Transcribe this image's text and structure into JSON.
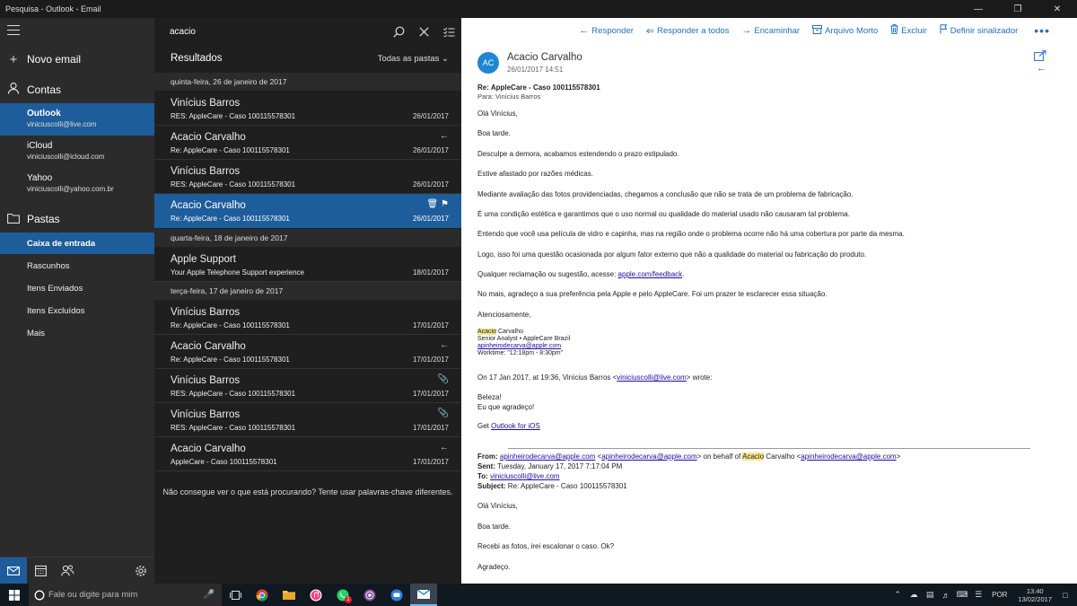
{
  "window": {
    "title": "Pesquisa - Outlook - Email"
  },
  "nav": {
    "new_mail": "Novo email",
    "accounts_label": "Contas",
    "accounts": [
      {
        "name": "Outlook",
        "email": "viniciuscolli@live.com"
      },
      {
        "name": "iCloud",
        "email": "viniciuscolli@icloud.com"
      },
      {
        "name": "Yahoo",
        "email": "viniciuscolli@yahoo.com.br"
      }
    ],
    "folders_label": "Pastas",
    "folders": [
      "Caixa de entrada",
      "Rascunhos",
      "Itens Enviados",
      "Itens Excluídos",
      "Mais"
    ]
  },
  "list": {
    "search_query": "acacio",
    "results_label": "Resultados",
    "filter_label": "Todas as pastas",
    "date_groups": [
      "quinta-feira, 26 de janeiro de 2017",
      "quarta-feira, 18 de janeiro de 2017",
      "terça-feira, 17 de janeiro de 2017"
    ],
    "messages": [
      {
        "sender": "Vinícius Barros",
        "subject": "RES: AppleCare - Caso 100115578301",
        "date": "26/01/2017",
        "flags": ""
      },
      {
        "sender": "Acacio Carvalho",
        "subject": "Re: AppleCare - Caso 100115578301",
        "date": "26/01/2017",
        "flags": "←"
      },
      {
        "sender": "Vinícius Barros",
        "subject": "RES: AppleCare - Caso 100115578301",
        "date": "26/01/2017",
        "flags": ""
      },
      {
        "sender": "Acacio Carvalho",
        "subject": "Re: AppleCare - Caso 100115578301",
        "date": "26/01/2017",
        "flags": "🗑 ⚑"
      },
      {
        "sender": "Apple Support",
        "subject": "Your Apple Telephone Support experience",
        "date": "18/01/2017",
        "flags": ""
      },
      {
        "sender": "Vinícius Barros",
        "subject": "Re: AppleCare - Caso 100115578301",
        "date": "17/01/2017",
        "flags": ""
      },
      {
        "sender": "Acacio Carvalho",
        "subject": "Re: AppleCare - Caso 100115578301",
        "date": "17/01/2017",
        "flags": "←"
      },
      {
        "sender": "Vinícius Barros",
        "subject": "RES: AppleCare - Caso 100115578301",
        "date": "17/01/2017",
        "flags": "📎"
      },
      {
        "sender": "Vinícius Barros",
        "subject": "RES: AppleCare - Caso 100115578301",
        "date": "17/01/2017",
        "flags": "📎"
      },
      {
        "sender": "Acacio Carvalho",
        "subject": "AppleCare - Caso 100115578301",
        "date": "17/01/2017",
        "flags": "←"
      }
    ],
    "empty_hint": "Não consegue ver o que está procurando? Tente usar palavras-chave diferentes."
  },
  "reader": {
    "toolbar": {
      "reply": "Responder",
      "reply_all": "Responder a todos",
      "forward": "Encaminhar",
      "archive": "Arquivo Morto",
      "delete": "Excluir",
      "flag": "Definir sinalizador"
    },
    "avatar_initials": "AC",
    "from_name": "Acacio Carvalho",
    "from_date": "26/01/2017 14:51",
    "subject": "Re: AppleCare - Caso 100115578301",
    "to": "Para: Vinícius Barros",
    "body": {
      "p1": "Olá Vinícius,",
      "p2": "Boa tarde.",
      "p3": "Desculpe a demora, acabamos estendendo o prazo estipulado.",
      "p4": "Estive afastado por razões médicas.",
      "p5": "Mediante avaliação das fotos providenciadas, chegamos a conclusão que não se trata de um problema de fabricação.",
      "p6": "É uma condição estética e garantimos que o uso normal ou qualidade do material usado não causaram tal problema.",
      "p7": "Entendo que você usa película de vidro e capinha, mas na região onde o problema ocorre não há uma cobertura por parte da mesma.",
      "p8": "Logo, isso foi uma questão ocasionada por algum fator externo que não a qualidade do material ou fabricação do produto.",
      "p9_pre": "Qualquer reclamação ou sugestão, acesse: ",
      "p9_link": "apple.com/feedback",
      "p9_post": ".",
      "p10": "No mais, agradeço a sua preferência pela Apple e pelo AppleCare. Foi um prazer te esclarecer essa situação.",
      "p11": "Atenciosamente,",
      "sig_first": "Acacio",
      "sig_last": " Carvalho",
      "sig_title": "Senior Analyst • AppleCare Brazil",
      "sig_email": "apinheirodecarva@apple.com",
      "sig_hours": "Worktime: \"12:18pm - 8:30pm\""
    },
    "quote": {
      "intro_pre": "On 17 Jan 2017, at 19:36, Vinícius Barros <",
      "intro_link": "viniciuscolli@live.com",
      "intro_post": "> wrote:",
      "q1": "Beleza!",
      "q2": "Eu que agradeço!",
      "q3_pre": "Get ",
      "q3_link": "Outlook for iOS",
      "from_label": "From:",
      "from_link1": "apinheirodecarva@apple.com",
      "from_mid1": " <",
      "from_link2": "apinheirodecarva@apple.com",
      "from_mid2": "> on behalf of ",
      "from_hl": "Acacio",
      "from_mid3": " Carvalho <",
      "from_link3": "apinheirodecarva@apple.com",
      "from_end": ">",
      "sent_label": "Sent:",
      "sent_value": " Tuesday, January 17, 2017 7:17:04 PM",
      "to_label": "To:",
      "to_link": "viniciuscolli@live.com",
      "subject_label": "Subject:",
      "subject_value": " Re: AppleCare - Caso 100115578301",
      "r1": "Olá Vinícius,",
      "r2": "Boa tarde.",
      "r3": "Recebi as fotos, irei escalonar o caso. Ok?",
      "r4": "Agradeço."
    }
  },
  "taskbar": {
    "search_placeholder": "Fale ou digite para mim",
    "lang": "POR",
    "time": "13:40",
    "date": "13/02/2017",
    "whatsapp_badge": "1"
  }
}
